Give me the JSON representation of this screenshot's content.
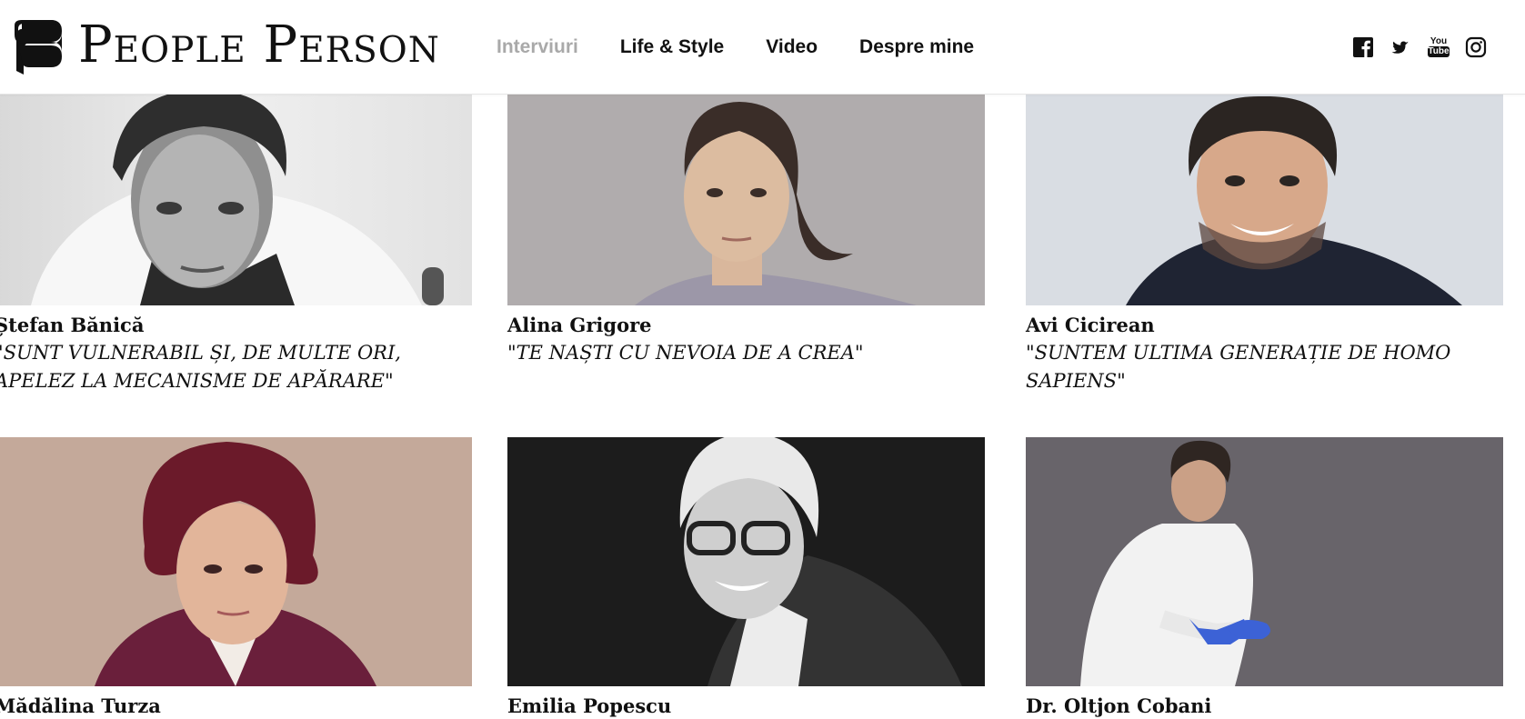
{
  "brand": {
    "name": "People Person"
  },
  "nav": {
    "items": [
      {
        "label": "Interviuri",
        "active": true
      },
      {
        "label": "Life & Style",
        "active": false
      },
      {
        "label": "Video",
        "active": false
      },
      {
        "label": "Despre mine",
        "active": false
      }
    ]
  },
  "social": {
    "icons": [
      "facebook-icon",
      "twitter-icon",
      "youtube-icon",
      "instagram-icon"
    ],
    "youtube_text_top": "You",
    "youtube_text_bottom": "Tube"
  },
  "interviews": [
    {
      "name": "Ștefan Bănică",
      "quote": "\"SUNT VULNERABIL ȘI, DE MULTE ORI, APELEZ LA MECANISME DE APĂRARE\""
    },
    {
      "name": "Alina Grigore",
      "quote": "\"TE NAȘTI CU NEVOIA DE A CREA\""
    },
    {
      "name": "Avi Cicirean",
      "quote": "\"SUNTEM ULTIMA GENERAȚIE DE HOMO SAPIENS\""
    },
    {
      "name": "Mădălina Turza",
      "quote": ""
    },
    {
      "name": "Emilia Popescu",
      "quote": ""
    },
    {
      "name": "Dr. Oltjon Cobani",
      "quote": ""
    }
  ],
  "colors": {
    "nav_active": "#a9a9a9",
    "text": "#111111"
  }
}
